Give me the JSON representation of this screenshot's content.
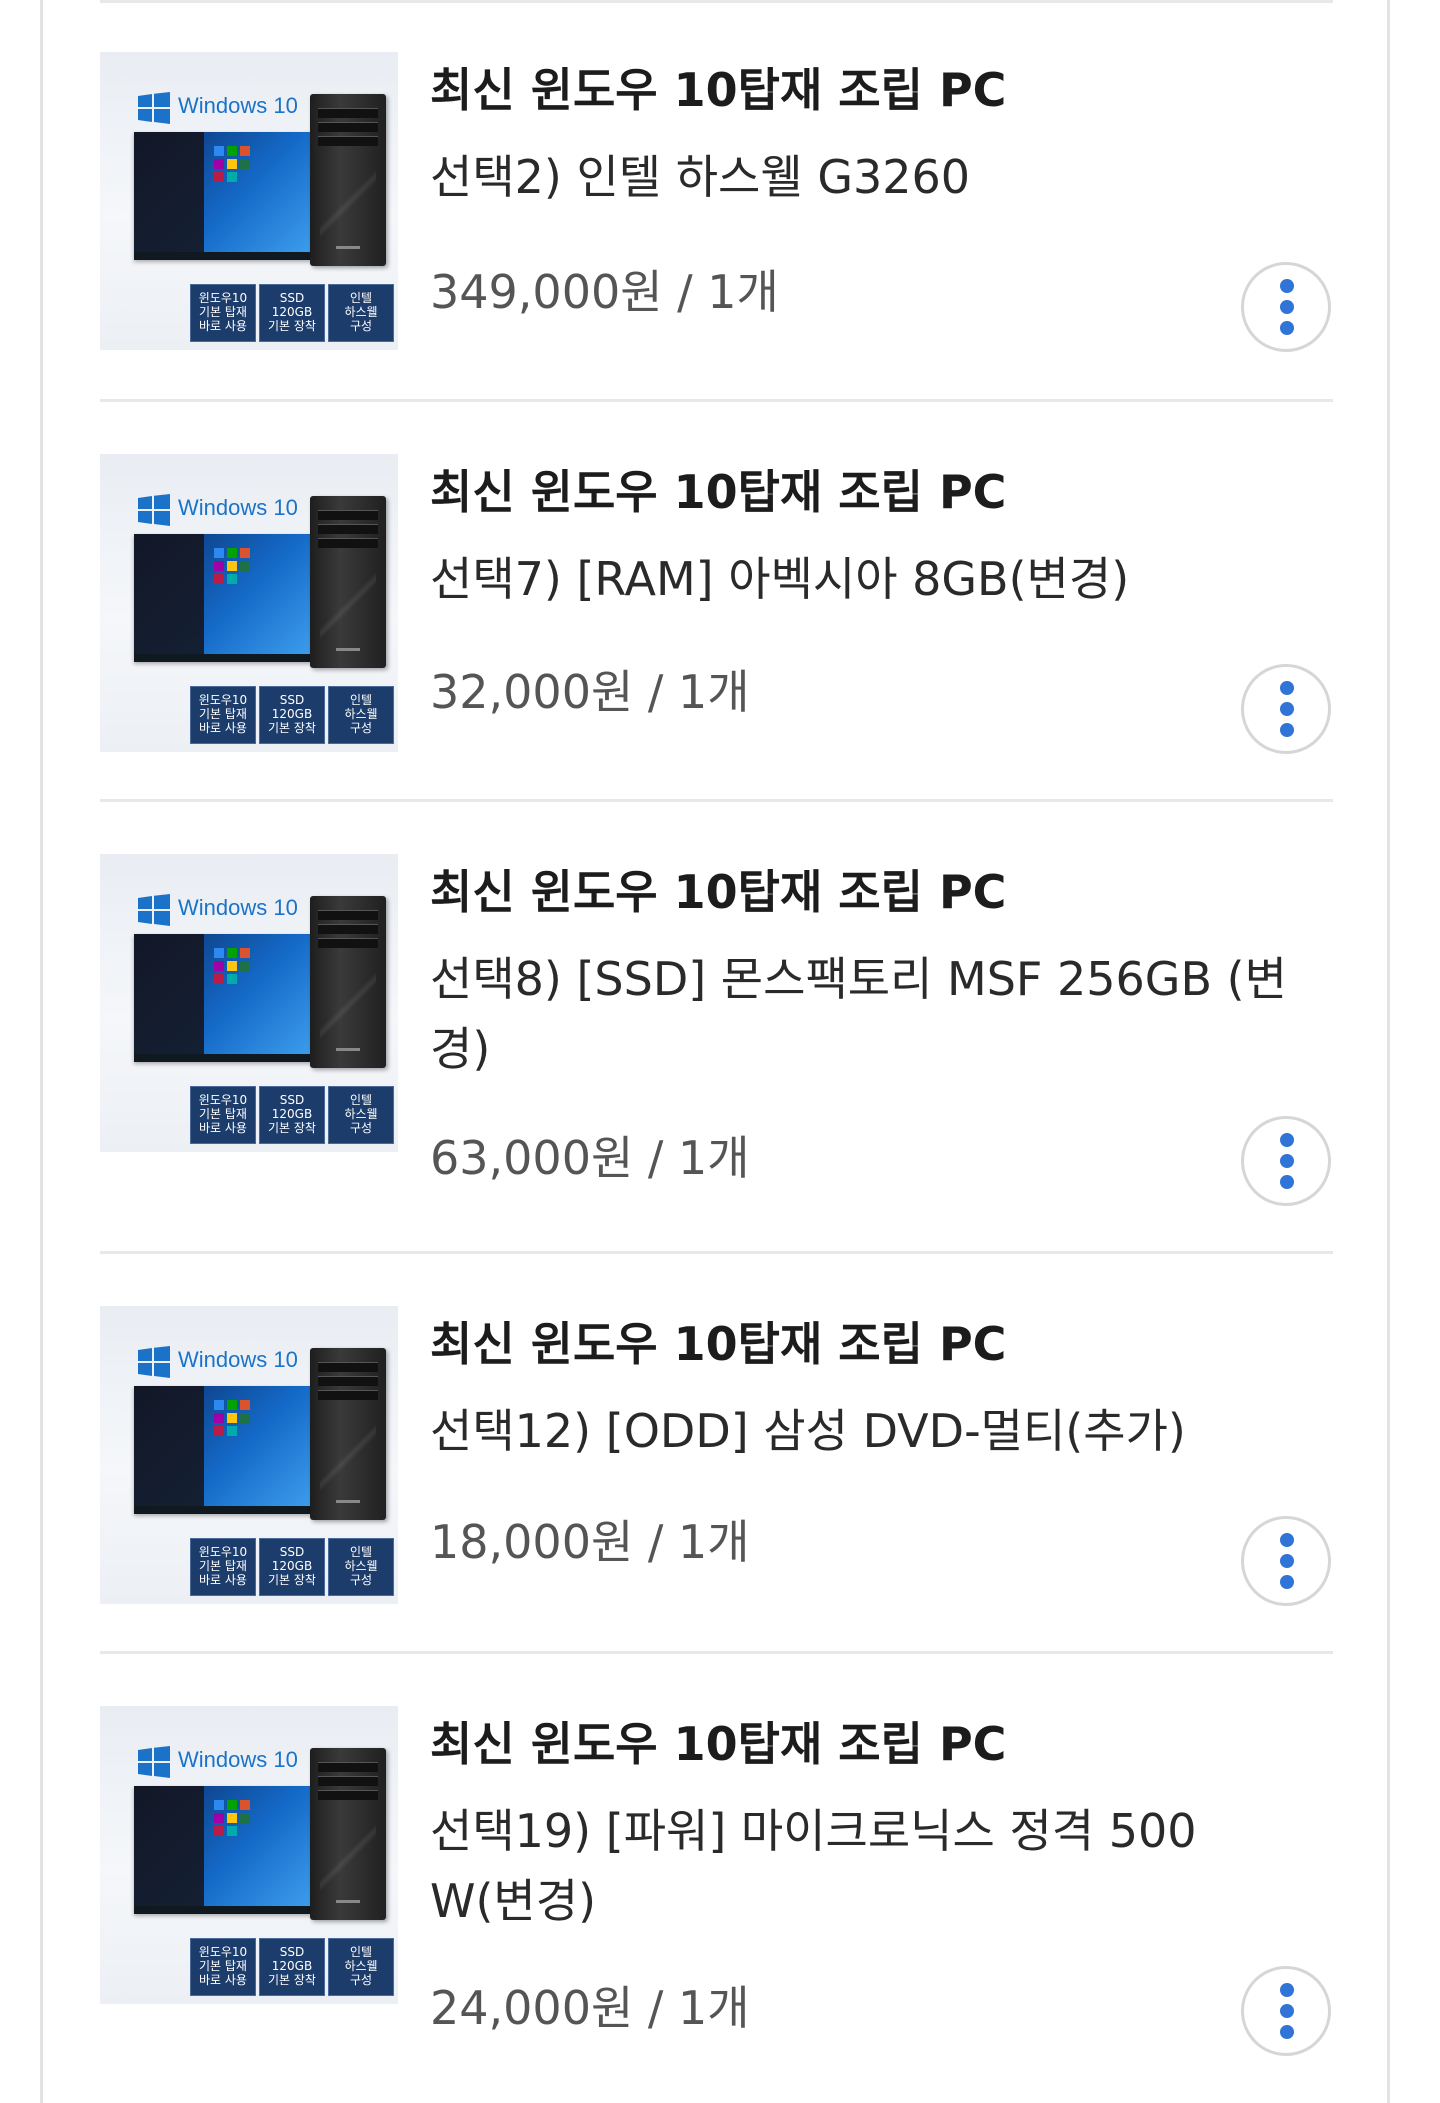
{
  "items": [
    {
      "title": "최신 윈도우 10탑재 조립 PC",
      "option": "선택2) 인텔 하스웰 G3260",
      "price": "349,000원 / 1개"
    },
    {
      "title": "최신 윈도우 10탑재 조립 PC",
      "option": "선택7) [RAM] 아벡시아 8GB(변경)",
      "price": "32,000원 / 1개"
    },
    {
      "title": "최신 윈도우 10탑재 조립 PC",
      "option": "선택8) [SSD] 몬스팩토리 MSF 256GB (변경)",
      "price": "63,000원 / 1개"
    },
    {
      "title": "최신 윈도우 10탑재 조립 PC",
      "option": "선택12) [ODD] 삼성 DVD-멀티(추가)",
      "price": "18,000원 / 1개"
    },
    {
      "title": "최신 윈도우 10탑재 조립 PC",
      "option": "선택19) [파워] 마이크로닉스 정격 500 W(변경)",
      "price": "24,000원 / 1개"
    }
  ],
  "thumbnail": {
    "os_label": "Windows 10",
    "badges": [
      "윈도우10\n기본 탑재\n바로 사용",
      "SSD\n120GB\n기본 장착",
      "인텔\n하스웰\n구성"
    ]
  },
  "colors": {
    "accent": "#2f74d6",
    "divider": "#e8e8e8",
    "badge": "#1c3c6b"
  },
  "icons": {
    "more": "more-vertical-icon",
    "windows": "windows-logo-icon"
  }
}
